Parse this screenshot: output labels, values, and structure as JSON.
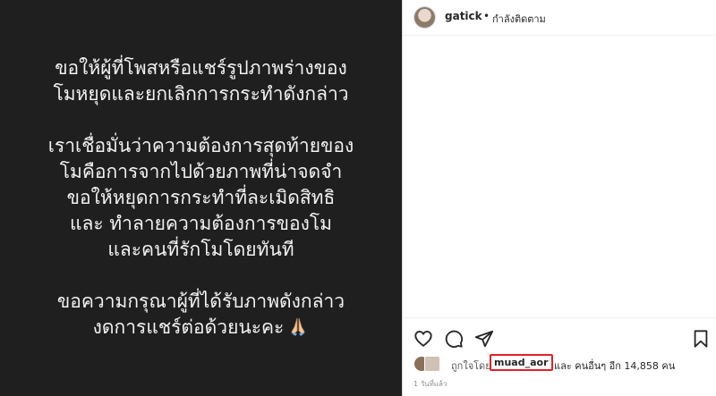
{
  "post": {
    "text": "ขอให้ผู้ที่โพสหรือแชร์รูปภาพร่างของ\nโมหยุดและยกเลิกการกระทำดังกล่าว\n\nเราเชื่อมั่นว่าความต้องการสุดท้ายของ\nโมคือการจากไปด้วยภาพที่น่าจดจำ\nขอให้หยุดการกระทำที่ละเมิดสิทธิ\nและ  ทำลายความต้องการของโม\nและคนที่รักโมโดยทันที\n\nขอความกรุณาผู้ที่ได้รับภาพดังกล่าว\nงดการแชร์ต่อด้วยนะคะ",
    "emoji_icon": "folded-hands-icon"
  },
  "header": {
    "username": "gatick",
    "separator": "•",
    "follow_status": "กำลังติดตาม"
  },
  "likes": {
    "prefix": "ถูกใจโดย",
    "liker": "muad_aor",
    "suffix": "และ คนอื่นๆ อีก 14,858 คน",
    "highlight_color": "#e0202a"
  },
  "timestamp": "1 วันที่แล้ว"
}
